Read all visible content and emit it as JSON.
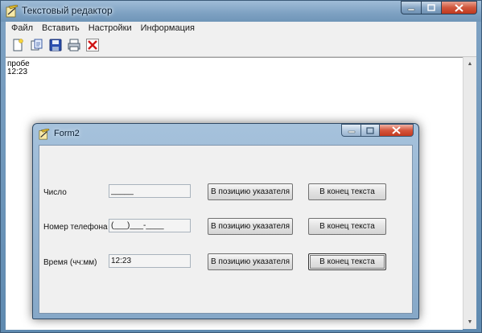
{
  "window": {
    "title": "Текстовый редактор",
    "caption": {
      "minimize": "▁",
      "maximize": "□",
      "close": "✕"
    }
  },
  "menu": [
    "Файл",
    "Вставить",
    "Настройки",
    "Информация"
  ],
  "toolbar": {
    "buttons": [
      {
        "name": "new-file-icon"
      },
      {
        "name": "open-file-icon"
      },
      {
        "name": "save-icon"
      },
      {
        "name": "print-icon"
      },
      {
        "name": "delete-icon"
      }
    ]
  },
  "editor": {
    "lines": [
      "пробе",
      "12:23"
    ]
  },
  "form2": {
    "title": "Form2",
    "caption": {
      "minimize": "▁",
      "maximize": "□",
      "close": "✕"
    },
    "rows": [
      {
        "label": "Число",
        "value": "_____",
        "insert_label": "В позицию указателя",
        "end_label": "В конец текста"
      },
      {
        "label": "Номер телефона",
        "value": "(___)___-____",
        "insert_label": "В позицию указателя",
        "end_label": "В конец текста"
      },
      {
        "label": "Время (чч:мм)",
        "value": "12:23",
        "insert_label": "В позицию указателя",
        "end_label": "В конец текста"
      }
    ]
  },
  "colors": {
    "titlebar": "#7ea1c2",
    "close_button": "#d0563c",
    "client_bg": "#f0f0f0"
  }
}
